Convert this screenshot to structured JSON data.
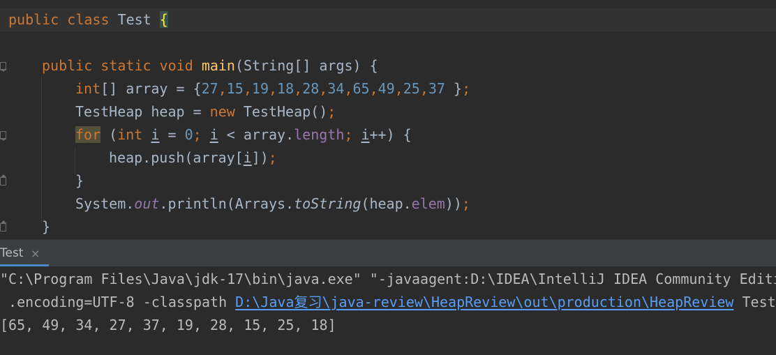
{
  "editor": {
    "line1": {
      "public": "public",
      "class": "class",
      "name": "Test",
      "brace": "{"
    },
    "line3": {
      "public": "public",
      "static": "static",
      "void": "void",
      "method": "main",
      "params": "(String[] args) {"
    },
    "line4": {
      "type": "int",
      "rest": "[] array = {",
      "n1": "27",
      "c1": ",",
      "n2": "15",
      "c2": ",",
      "n3": "19",
      "c3": ",",
      "n4": "18",
      "c4": ",",
      "n5": "28",
      "c5": ",",
      "n6": "34",
      "c6": ",",
      "n7": "65",
      "c7": ",",
      "n8": "49",
      "c8": ",",
      "n9": "25",
      "c9": ",",
      "n10": "37",
      "end": " }",
      "semi": ";"
    },
    "line5": {
      "a": "TestHeap heap = ",
      "new": "new",
      "b": " TestHeap()",
      "semi": ";"
    },
    "line6": {
      "for": "for",
      "a": " (",
      "int": "int",
      "b": " ",
      "i1": "i",
      "c": " = ",
      "zero": "0",
      "semi1": ";",
      "d": " ",
      "i2": "i",
      "e": " < array.",
      "length": "length",
      "semi2": ";",
      "f": " ",
      "i3": "i",
      "g": "++) {"
    },
    "line7": {
      "a": "heap.push(array[",
      "i": "i",
      "b": "])",
      "semi": ";"
    },
    "line8": {
      "brace": "}"
    },
    "line9": {
      "a": "System.",
      "out": "out",
      "b": ".println(Arrays.",
      "toString": "toString",
      "c": "(heap.",
      "elem": "elem",
      "d": "))",
      "semi": ";"
    },
    "line10": {
      "brace": "}"
    }
  },
  "run_tab": {
    "label": "Test",
    "close": "×"
  },
  "console": {
    "line1": "\"C:\\Program Files\\Java\\jdk-17\\bin\\java.exe\" \"-javaagent:D:\\IDEA\\IntelliJ IDEA Community Editi",
    "line2_prefix": " .encoding=UTF-8 -classpath ",
    "line2_link": "D:\\Java复习\\java-review\\HeapReview\\out\\production\\HeapReview",
    "line2_suffix": " Test",
    "line3": "[65, 49, 34, 27, 37, 19, 28, 15, 25, 18]"
  },
  "colors": {
    "background": "#2b2b2b",
    "keyword": "#cc7832",
    "method": "#ffc66d",
    "number": "#6897bb",
    "field": "#9876aa",
    "link": "#589df6"
  }
}
